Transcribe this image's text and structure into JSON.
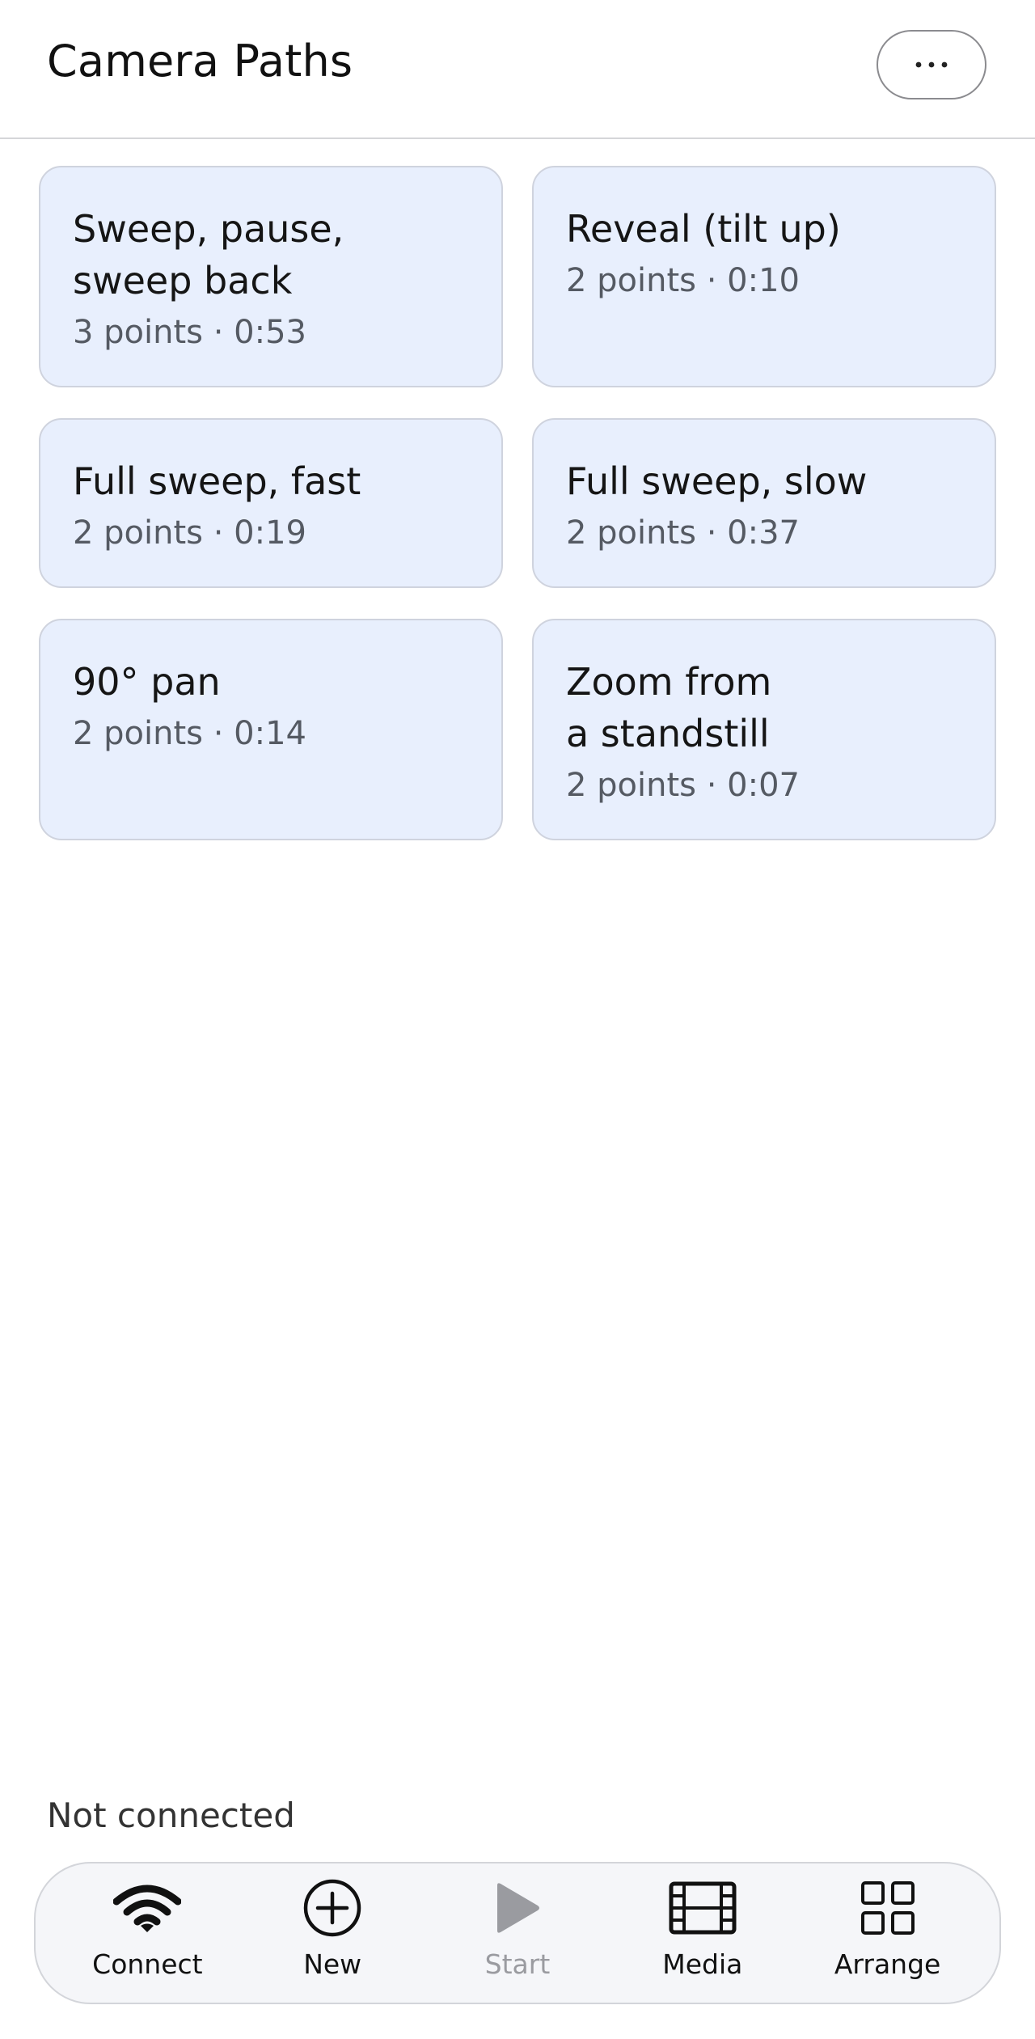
{
  "header": {
    "title": "Camera Paths",
    "more_label": "···"
  },
  "paths": [
    {
      "title": "Sweep, pause,\nsweep back",
      "meta": "3 points · 0:53"
    },
    {
      "title": "Reveal (tilt up)",
      "meta": "2 points · 0:10"
    },
    {
      "title": "Full sweep, fast",
      "meta": "2 points · 0:19"
    },
    {
      "title": "Full sweep, slow",
      "meta": "2 points · 0:37"
    },
    {
      "title": "90° pan",
      "meta": "2 points · 0:14"
    },
    {
      "title": "Zoom from\na standstill",
      "meta": "2 points · 0:07"
    }
  ],
  "status": "Not connected",
  "toolbar": {
    "connect_label": "Connect",
    "new_label": "New",
    "start_label": "Start",
    "media_label": "Media",
    "arrange_label": "Arrange"
  },
  "icons": {
    "connect": "wifi-icon",
    "new": "plus-circle-icon",
    "start": "play-icon",
    "media": "film-icon",
    "arrange": "grid-icon"
  },
  "colors": {
    "card_background": "#e8effd",
    "card_border": "#cfd3de",
    "disabled_text": "#9a9ba0"
  }
}
